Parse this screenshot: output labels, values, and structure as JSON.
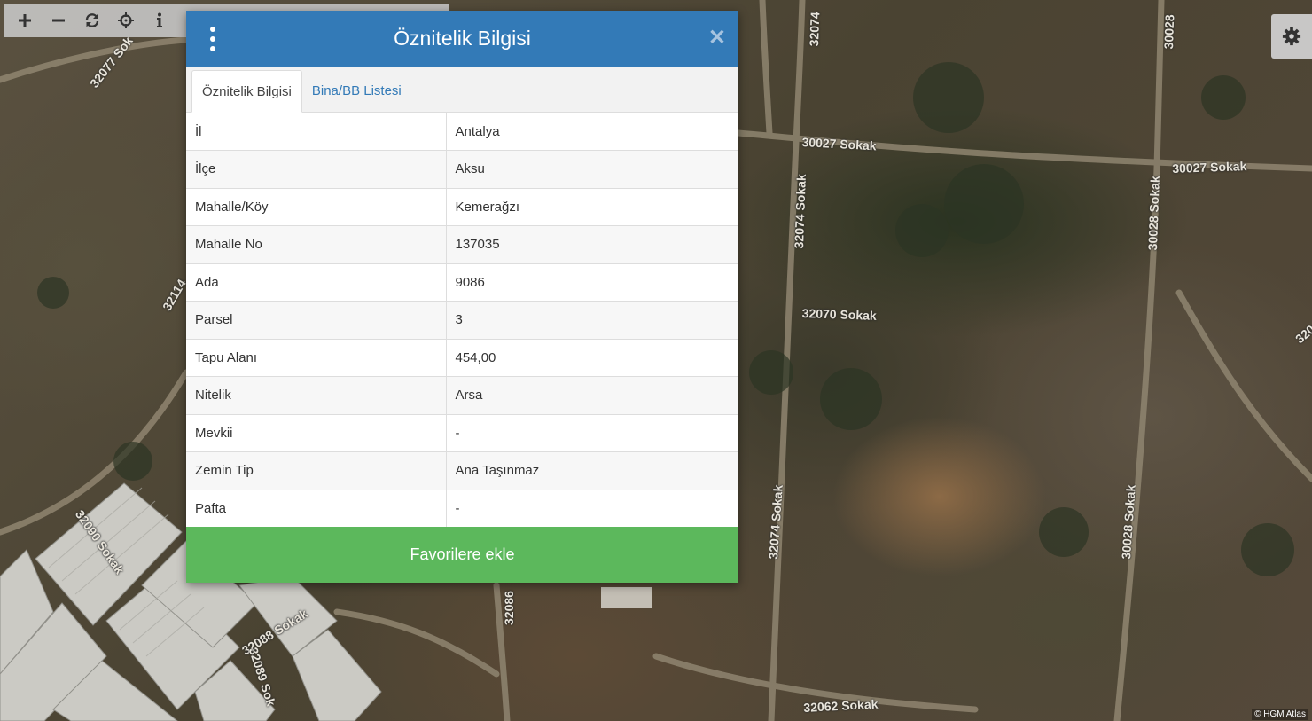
{
  "dialog": {
    "title": "Öznitelik Bilgisi",
    "tabs": [
      {
        "label": "Öznitelik Bilgisi",
        "active": true
      },
      {
        "label": "Bina/BB Listesi",
        "active": false
      }
    ],
    "rows": [
      {
        "key": "İl",
        "value": "Antalya"
      },
      {
        "key": "İlçe",
        "value": "Aksu"
      },
      {
        "key": "Mahalle/Köy",
        "value": "Kemerağzı"
      },
      {
        "key": "Mahalle No",
        "value": "137035"
      },
      {
        "key": "Ada",
        "value": "9086"
      },
      {
        "key": "Parsel",
        "value": "3"
      },
      {
        "key": "Tapu Alanı",
        "value": "454,00"
      },
      {
        "key": "Nitelik",
        "value": "Arsa"
      },
      {
        "key": "Mevkii",
        "value": "-"
      },
      {
        "key": "Zemin Tip",
        "value": "Ana Taşınmaz"
      },
      {
        "key": "Pafta",
        "value": "-"
      }
    ],
    "favorite_button": "Favorilere ekle",
    "header_color": "#337ab7",
    "button_color": "#5cb85c"
  },
  "toolbar": {
    "buttons": [
      "plus-icon",
      "minus-icon",
      "refresh-icon",
      "crosshair-icon",
      "info-icon"
    ]
  },
  "map": {
    "road_labels": [
      "30027 Sokak",
      "30027 Sokak",
      "32074 Sokak",
      "32074 Sokak",
      "32070 Sokak",
      "30028 Sokak",
      "30028 Sokak",
      "32062 Sokak",
      "32090 Sokak",
      "32088 Sokak",
      "32089 Sok",
      "32086",
      "32077 Sok",
      "32114",
      "32074",
      "30028",
      "320"
    ],
    "attribution": "© HGM Atlas"
  }
}
